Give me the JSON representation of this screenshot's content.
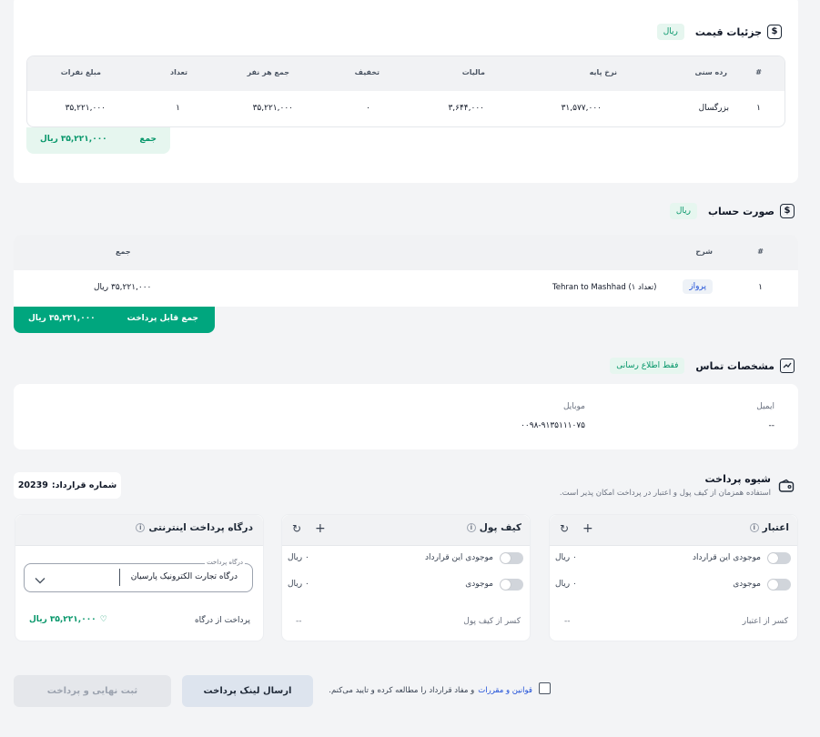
{
  "price_details": {
    "title": "جزئیات قیمت",
    "currency_badge": "ریال",
    "headers": {
      "idx": "#",
      "age": "رده سنی",
      "base": "نرخ پایه",
      "tax": "مالیات",
      "discount": "تخفیف",
      "per_person": "جمع هر نفر",
      "count": "تعداد",
      "total": "مبلغ نفرات"
    },
    "row": {
      "idx": "۱",
      "age": "بزرگسال",
      "base": "۳۱,۵۷۷,۰۰۰",
      "tax": "۳,۶۴۴,۰۰۰",
      "discount": "۰",
      "per_person": "۳۵,۲۲۱,۰۰۰",
      "count": "۱",
      "total": "۳۵,۲۲۱,۰۰۰"
    },
    "sum_label": "جمع",
    "sum_value": "۳۵,۲۲۱,۰۰۰ ریال"
  },
  "invoice": {
    "title": "صورت حساب",
    "currency_badge": "ریال",
    "headers": {
      "idx": "#",
      "desc": "شرح",
      "sum": "جمع"
    },
    "row": {
      "idx": "۱",
      "tag": "پرواز",
      "desc": "Tehran to Mashhad (تعداد ۱)",
      "amount": "۳۵,۲۲۱,۰۰۰ ریال"
    },
    "payable_label": "جمع قابل پرداخت",
    "payable_value": "۳۵,۲۲۱,۰۰۰ ریال"
  },
  "contact": {
    "title": "مشخصات تماس",
    "badge": "فقط اطلاع رسانی",
    "email_label": "ایمیل",
    "email_value": "--",
    "mobile_label": "موبایل",
    "mobile_value": "۰۰۹۸-۹۱۳۵۱۱۱۰۷۵"
  },
  "payment": {
    "title": "شیوه پرداخت",
    "subtitle": "استفاده همزمان از کیف پول و اعتبار در پرداخت امکان پذیر است.",
    "contract_label": "شماره قرارداد:",
    "contract_number": "20239",
    "credit": {
      "title": "اعتبار",
      "contract_balance_label": "موجودی این قرارداد",
      "contract_balance_value": "۰ ریال",
      "balance_label": "موجودی",
      "balance_value": "۰ ریال",
      "deduct_label": "کسر از اعتبار",
      "deduct_value": "--"
    },
    "wallet": {
      "title": "کیف پول",
      "contract_balance_label": "موجودی این قرارداد",
      "contract_balance_value": "۰ ریال",
      "balance_label": "موجودی",
      "balance_value": "۰ ریال",
      "deduct_label": "کسر از کیف پول",
      "deduct_value": "--"
    },
    "gateway": {
      "title": "درگاه پرداخت اینترنتی",
      "select_label": "درگاه پرداخت",
      "select_value": "درگاه تجارت الکترونیک پارسیان",
      "pay_label": "پرداخت از درگاه",
      "pay_value": "۳۵,۲۲۱,۰۰۰ ریال"
    }
  },
  "footer": {
    "terms_link": "قوانین و مقررات",
    "terms_text": "و مفاد قرارداد را مطالعه کرده و تایید می‌کنم.",
    "send_link_button": "ارسال لینک پرداخت",
    "finalize_button": "ثبت نهایی و پرداخت"
  },
  "colors": {
    "accent": "#00a67e",
    "link": "#1d4ed8"
  }
}
